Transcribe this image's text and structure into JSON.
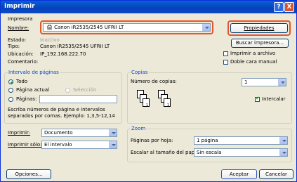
{
  "window": {
    "title": "Imprimir",
    "help_glyph": "?",
    "close_glyph": "X"
  },
  "printer": {
    "group_label": "Impresora",
    "name_label": "Nombre:",
    "name_value": "Canon iR2535/2545 UFRII LT",
    "properties_button": "Propiedades",
    "status_label": "Estado:",
    "status_value": "Inactivo",
    "type_label": "Tipo:",
    "type_value": "Canon iR2535/2545 UFRII LT",
    "location_label": "Ubicación:",
    "location_value": "IP_192.168.222.70",
    "comment_label": "Comentario:",
    "comment_value": "",
    "find_button": "Buscar impresora...",
    "print_to_file_label": "Imprimir a archivo",
    "print_to_file_checked": false,
    "manual_duplex_label": "Doble cara manual",
    "manual_duplex_checked": false
  },
  "page_range": {
    "group_label": "Intervalo de páginas",
    "all_label": "Todo",
    "current_label": "Página actual",
    "selection_label": "Selección",
    "pages_label": "Páginas:",
    "pages_value": "",
    "selected": "all",
    "hint": "Escriba números de página e intervalos separados por comas. Ejemplo: 1,3,5-12,14"
  },
  "copies": {
    "group_label": "Copias",
    "count_label": "Número de copias:",
    "count_value": "1",
    "collate_label": "Intercalar",
    "collate_checked": true,
    "page_numbers": [
      "3",
      "2",
      "1",
      "3",
      "2",
      "1"
    ]
  },
  "print_what": {
    "label": "Imprimir:",
    "value": "Documento"
  },
  "print_only": {
    "label": "Imprimir sólo:",
    "value": "El intervalo"
  },
  "zoom": {
    "group_label": "Zoom",
    "pages_per_sheet_label": "Páginas por hoja:",
    "pages_per_sheet_value": "1 página",
    "scale_label": "Escalar al tamaño del papel:",
    "scale_value": "Sin escala"
  },
  "footer": {
    "options_button": "Opciones...",
    "ok_button": "Aceptar",
    "cancel_button": "Cancelar"
  },
  "colors": {
    "title_bar": "#0a4ac8",
    "highlight": "#e4572e",
    "dialog_bg": "#ece9d8",
    "group_label": "#0046d5"
  }
}
